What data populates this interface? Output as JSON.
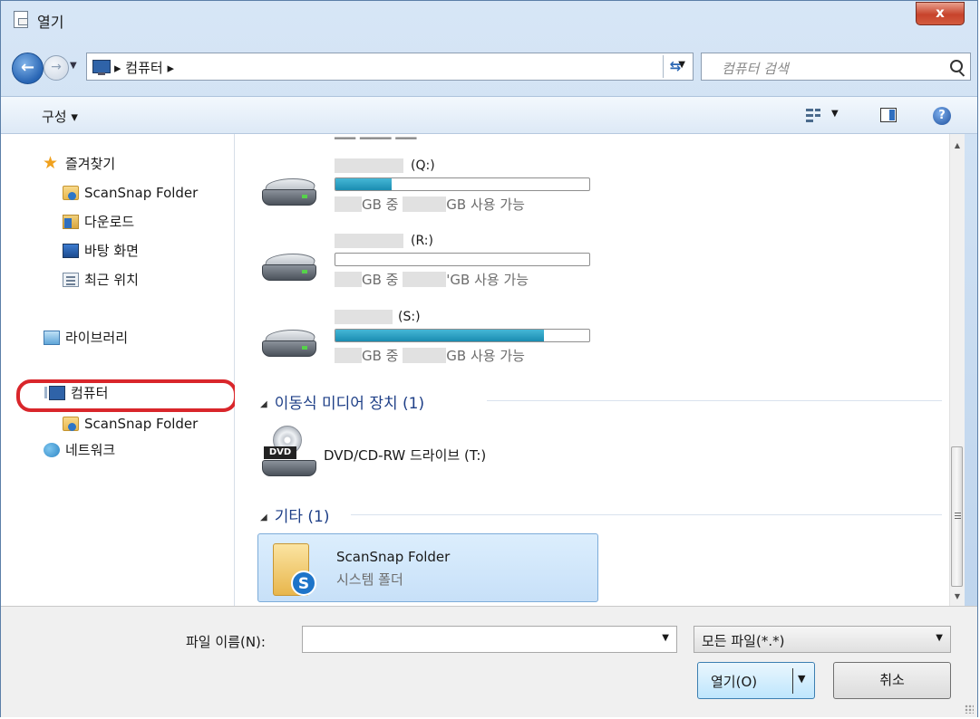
{
  "window": {
    "title": "열기",
    "close_label": "x"
  },
  "address": {
    "crumb": "▸ 컴퓨터 ▸",
    "search_placeholder": "컴퓨터 검색"
  },
  "toolbar": {
    "organize_label": "구성 ▾",
    "help_label": "?"
  },
  "nav": {
    "favorites": "즐겨찾기",
    "scansnap_folder": "ScanSnap Folder",
    "downloads": "다운로드",
    "desktop": "바탕 화면",
    "recent": "최근 위치",
    "libraries": "라이브러리",
    "computer": "컴퓨터",
    "computer_scansnap": "ScanSnap Folder",
    "network": "네트워크"
  },
  "drives": [
    {
      "letter": "(Q:)",
      "used_fraction": 0.22,
      "gb_of": "GB 중",
      "gb_free": "GB 사용 가능"
    },
    {
      "letter": "(R:)",
      "used_fraction": 0.0,
      "gb_of": "GB 중",
      "gb_free": "'GB 사용 가능"
    },
    {
      "letter": "(S:)",
      "used_fraction": 0.82,
      "gb_of": "GB 중",
      "gb_free": "GB 사용 가능"
    }
  ],
  "groups": {
    "removable": "이동식 미디어 장치 (1)",
    "other": "기타 (1)"
  },
  "dvd": {
    "label": "DVD",
    "name": "DVD/CD-RW 드라이브 (T:)"
  },
  "folder_tile": {
    "name": "ScanSnap Folder",
    "type": "시스템 폴더",
    "badge": "S"
  },
  "bottom": {
    "filename_label": "파일 이름(N):",
    "filename_value": "",
    "filter_value": "모든 파일(*.*)",
    "open_label": "열기(O)",
    "cancel_label": "취소"
  },
  "colors": {
    "highlight_ring": "#d9262b",
    "progress_fill": "#1a8cb1",
    "group_header": "#1e3f87"
  }
}
